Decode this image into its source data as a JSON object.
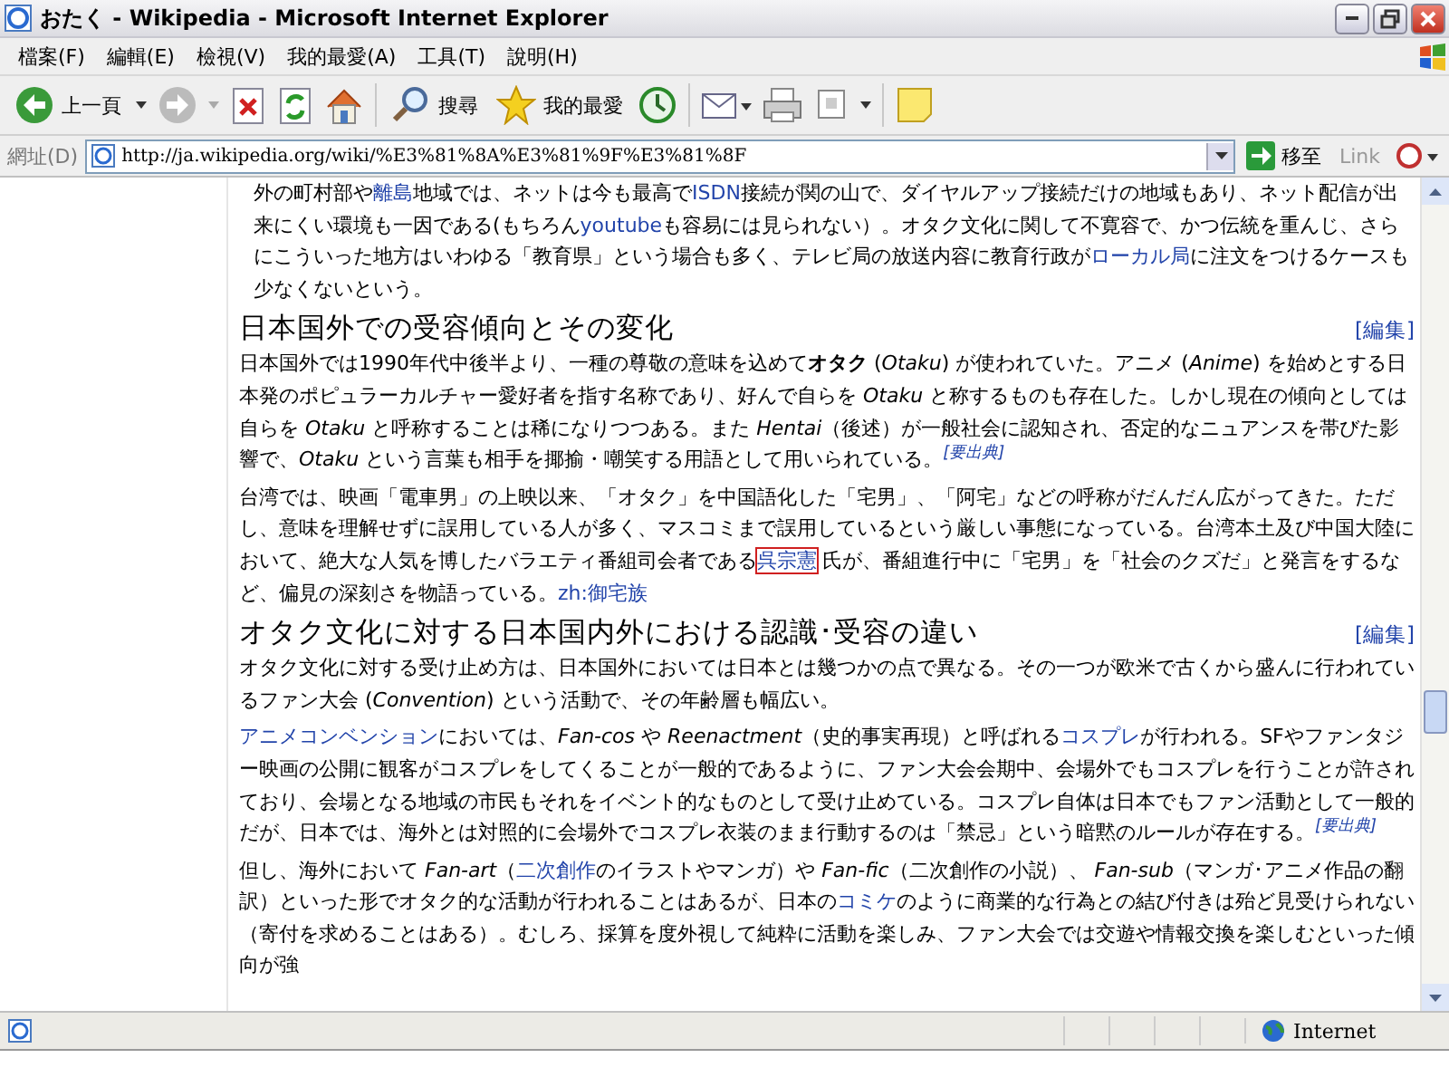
{
  "window": {
    "title": "おたく - Wikipedia - Microsoft Internet Explorer"
  },
  "menu": [
    "檔案(F)",
    "編輯(E)",
    "檢視(V)",
    "我的最愛(A)",
    "工具(T)",
    "說明(H)"
  ],
  "toolbar": {
    "back": "上一頁",
    "search": "搜尋",
    "favorites": "我的最愛"
  },
  "address_bar": {
    "label": "網址(D)",
    "value": "http://ja.wikipedia.org/wiki/%E3%81%8A%E3%81%9F%E3%81%8F",
    "go": "移至",
    "links": "Link"
  },
  "article": [
    {
      "kind": "paragraph",
      "segments": [
        {
          "kind": "text",
          "text": "外の町村部や"
        },
        {
          "kind": "link",
          "text": "離島"
        },
        {
          "kind": "text",
          "text": "地域では、ネットは今も最高で"
        },
        {
          "kind": "link",
          "text": "ISDN"
        },
        {
          "kind": "text",
          "text": "接続が関の山で、ダイヤルアップ接続だけの地域もあり、ネット配信が出来にくい環境も一因である(もちろん"
        },
        {
          "kind": "link",
          "text": "youtube"
        },
        {
          "kind": "text",
          "text": "も容易には見られない）。オタク文化に関して不寛容で、かつ伝統を重んじ、さらにこういった地方はいわゆる「教育県」という場合も多く、テレビ局の放送内容に教育行政が"
        },
        {
          "kind": "link",
          "text": "ローカル局"
        },
        {
          "kind": "text",
          "text": "に注文をつけるケースも少なくないという。"
        }
      ]
    },
    {
      "kind": "heading",
      "text": "日本国外での受容傾向とその変化",
      "edit": "[編集]"
    },
    {
      "kind": "paragraph",
      "segments": [
        {
          "kind": "text",
          "text": "日本国外では1990年代中後半より、一種の尊敬の意味を込めて**オタク** (*Otaku*) が使われていた。アニメ (*Anime*) を始めとする日本発のポピュラーカルチャー愛好者を指す名称であり、好んで自らを *Otaku* と称するものも存在した。しかし現在の傾向としては自らを *Otaku* と呼称することは稀になりつつある。また *Hentai*（後述）が一般社会に認知され、否定的なニュアンスを帯びた影響で、*Otaku* という言葉も相手を揶揄・嘲笑する用語として用いられている。"
        },
        {
          "kind": "cite",
          "text": "[要出典]"
        }
      ]
    },
    {
      "kind": "paragraph",
      "segments": [
        {
          "kind": "text",
          "text": "台湾では、映画「電車男」の上映以来、「オタク」を中国語化した「宅男」、「阿宅」などの呼称がだんだん広がってきた。ただし、意味を理解せずに誤用している人が多く、マスコミまで誤用しているという厳しい事態になっている。台湾本土及び中国大陸において、絶大な人気を博したバラエティ番組司会者である"
        },
        {
          "kind": "link",
          "text": "呉宗憲",
          "outlined": true
        },
        {
          "kind": "text",
          "text": "氏が、番組進行中に「宅男」を「社会のクズだ」と発言をするなど、偏見の深刻さを物語っている。"
        },
        {
          "kind": "link",
          "text": "zh:御宅族"
        }
      ]
    },
    {
      "kind": "heading",
      "text": "オタク文化に対する日本国内外における認識･受容の違い",
      "edit": "[編集]"
    },
    {
      "kind": "paragraph",
      "segments": [
        {
          "kind": "text",
          "text": "オタク文化に対する受け止め方は、日本国外においては日本とは幾つかの点で異なる。その一つが欧米で古くから盛んに行われているファン大会 (*Convention*) という活動で、その年齢層も幅広い。"
        }
      ]
    },
    {
      "kind": "paragraph",
      "segments": [
        {
          "kind": "link",
          "text": "アニメコンベンション"
        },
        {
          "kind": "text",
          "text": "においては、*Fan-cos* や *Reenactment*（史的事実再現）と呼ばれる"
        },
        {
          "kind": "link",
          "text": "コスプレ"
        },
        {
          "kind": "text",
          "text": "が行われる。SFやファンタジー映画の公開に観客がコスプレをしてくることが一般的であるように、ファン大会会期中、会場外でもコスプレを行うことが許されており、会場となる地域の市民もそれをイベント的なものとして受け止めている。コスプレ自体は日本でもファン活動として一般的だが、日本では、海外とは対照的に会場外でコスプレ衣装のまま行動するのは「禁忌」という暗黙のルールが存在する。"
        },
        {
          "kind": "cite",
          "text": "[要出典]"
        }
      ]
    },
    {
      "kind": "paragraph",
      "segments": [
        {
          "kind": "text",
          "text": "但し、海外において *Fan-art*（"
        },
        {
          "kind": "link",
          "text": "二次創作"
        },
        {
          "kind": "text",
          "text": "のイラストやマンガ）や *Fan-fic*（二次創作の小説）、 *Fan-sub*（マンガ･アニメ作品の翻訳）といった形でオタク的な活動が行われることはあるが、日本の"
        },
        {
          "kind": "link",
          "text": "コミケ"
        },
        {
          "kind": "text",
          "text": "のように商業的な行為との結び付きは殆ど見受けられない（寄付を求めることはある）。むしろ、採算を度外視して純粋に活動を楽しみ、ファン大会では交遊や情報交換を楽しむといった傾向が強"
        }
      ]
    }
  ],
  "status_bar": {
    "zone": "Internet"
  }
}
